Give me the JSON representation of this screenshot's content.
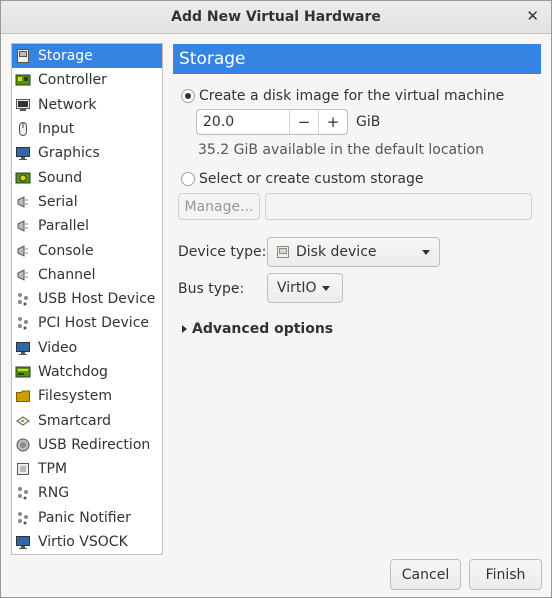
{
  "window": {
    "title": "Add New Virtual Hardware",
    "close_glyph": "✕"
  },
  "sidebar": {
    "items": [
      {
        "label": "Storage",
        "icon": "storage-icon"
      },
      {
        "label": "Controller",
        "icon": "controller-icon"
      },
      {
        "label": "Network",
        "icon": "network-icon"
      },
      {
        "label": "Input",
        "icon": "mouse-icon"
      },
      {
        "label": "Graphics",
        "icon": "monitor-icon"
      },
      {
        "label": "Sound",
        "icon": "sound-card-icon"
      },
      {
        "label": "Serial",
        "icon": "serial-icon"
      },
      {
        "label": "Parallel",
        "icon": "parallel-icon"
      },
      {
        "label": "Console",
        "icon": "console-icon"
      },
      {
        "label": "Channel",
        "icon": "channel-icon"
      },
      {
        "label": "USB Host Device",
        "icon": "usb-icon"
      },
      {
        "label": "PCI Host Device",
        "icon": "pci-icon"
      },
      {
        "label": "Video",
        "icon": "video-icon"
      },
      {
        "label": "Watchdog",
        "icon": "watchdog-icon"
      },
      {
        "label": "Filesystem",
        "icon": "folder-icon"
      },
      {
        "label": "Smartcard",
        "icon": "smartcard-icon"
      },
      {
        "label": "USB Redirection",
        "icon": "usb-redirection-icon"
      },
      {
        "label": "TPM",
        "icon": "tpm-icon"
      },
      {
        "label": "RNG",
        "icon": "rng-icon"
      },
      {
        "label": "Panic Notifier",
        "icon": "panic-notifier-icon"
      },
      {
        "label": "Virtio VSOCK",
        "icon": "vsock-icon"
      }
    ],
    "selected_index": 0
  },
  "main": {
    "header": "Storage",
    "create_disk_label": "Create a disk image for the virtual machine",
    "disk_size_value": "20.0",
    "minus_glyph": "−",
    "plus_glyph": "+",
    "size_unit": "GiB",
    "available_text": "35.2 GiB available in the default location",
    "custom_storage_label": "Select or create custom storage",
    "manage_label": "Manage...",
    "custom_path_value": "",
    "device_type_label": "Device type:",
    "device_type_value": "Disk device",
    "bus_type_label": "Bus type:",
    "bus_type_value": "VirtIO",
    "advanced_label": "Advanced options"
  },
  "footer": {
    "cancel_label": "Cancel",
    "finish_label": "Finish"
  },
  "colors": {
    "accent": "#3584e4",
    "window_bg": "#f6f5f4"
  }
}
